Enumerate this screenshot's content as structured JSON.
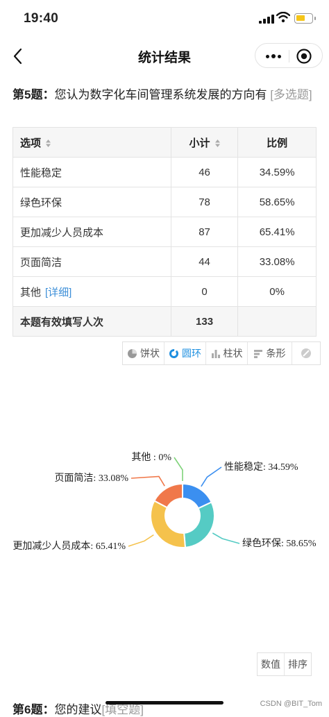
{
  "status_bar": {
    "time": "19:40"
  },
  "nav": {
    "title": "统计结果"
  },
  "question": {
    "number": "第5题：",
    "text": "您认为数字化车间管理系统发展的方向有",
    "type": "[多选题]"
  },
  "table": {
    "headers": [
      "选项",
      "小计",
      "比例"
    ],
    "rows": [
      {
        "option": "性能稳定",
        "count": "46",
        "ratio": "34.59%"
      },
      {
        "option": "绿色环保",
        "count": "78",
        "ratio": "58.65%"
      },
      {
        "option": "更加减少人员成本",
        "count": "87",
        "ratio": "65.41%"
      },
      {
        "option": "页面简洁",
        "count": "44",
        "ratio": "33.08%"
      },
      {
        "option": "其他",
        "detail": "[详细]",
        "count": "0",
        "ratio": "0%"
      }
    ],
    "total": {
      "label": "本题有效填写人次",
      "count": "133",
      "ratio": ""
    }
  },
  "chart_tabs": [
    {
      "label": "饼状",
      "icon": "pie-icon"
    },
    {
      "label": "圆环",
      "icon": "donut-icon",
      "active": true
    },
    {
      "label": "柱状",
      "icon": "column-icon"
    },
    {
      "label": "条形",
      "icon": "bar-icon"
    },
    {
      "label": "",
      "icon": "disable-icon"
    }
  ],
  "chart_data": {
    "type": "pie",
    "subtype": "donut",
    "categories": [
      "性能稳定",
      "绿色环保",
      "更加减少人员成本",
      "页面简洁",
      "其他"
    ],
    "values": [
      46,
      78,
      87,
      44,
      0
    ],
    "labels": [
      "性能稳定: 34.59%",
      "绿色环保: 58.65%",
      "更加减少人员成本: 65.41%",
      "页面简洁: 33.08%",
      "其他  : 0%"
    ],
    "colors": [
      "#3b8ff0",
      "#55cbc4",
      "#f5c24c",
      "#f0784a",
      "#7fd27a"
    ]
  },
  "value_buttons": {
    "value": "数值",
    "sort": "排序"
  },
  "next_question": {
    "number": "第6题：",
    "text": "您的建议",
    "type": "[填空题]"
  },
  "watermark": "CSDN @BIT_Tom"
}
